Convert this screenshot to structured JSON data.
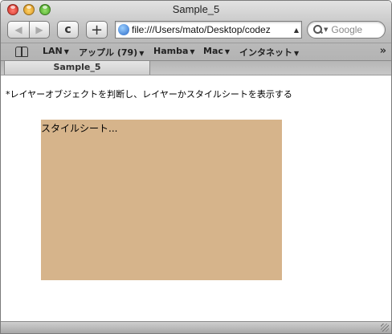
{
  "window": {
    "title": "Sample_5"
  },
  "toolbar": {
    "back_icon": "back-arrow-icon",
    "forward_icon": "forward-arrow-icon",
    "reload_glyph": "c",
    "add_glyph": "+",
    "url": "file:///Users/mato/Desktop/codez",
    "search_placeholder": "Google"
  },
  "bookmarks": {
    "items": [
      {
        "label": "LAN",
        "has_menu": true
      },
      {
        "label": "アップル (79)",
        "has_menu": true
      },
      {
        "label": "Hamba",
        "has_menu": true
      },
      {
        "label": "Mac",
        "has_menu": true
      },
      {
        "label": "インタネット",
        "has_menu": true
      }
    ],
    "more_glyph": "»"
  },
  "tabs": [
    {
      "label": "Sample_5",
      "active": true
    }
  ],
  "content": {
    "description": "*レイヤーオブジェクトを判断し、レイヤーかスタイルシートを表示する",
    "layer_text": "スタイルシート...",
    "layer_color": "#d6b48b"
  }
}
